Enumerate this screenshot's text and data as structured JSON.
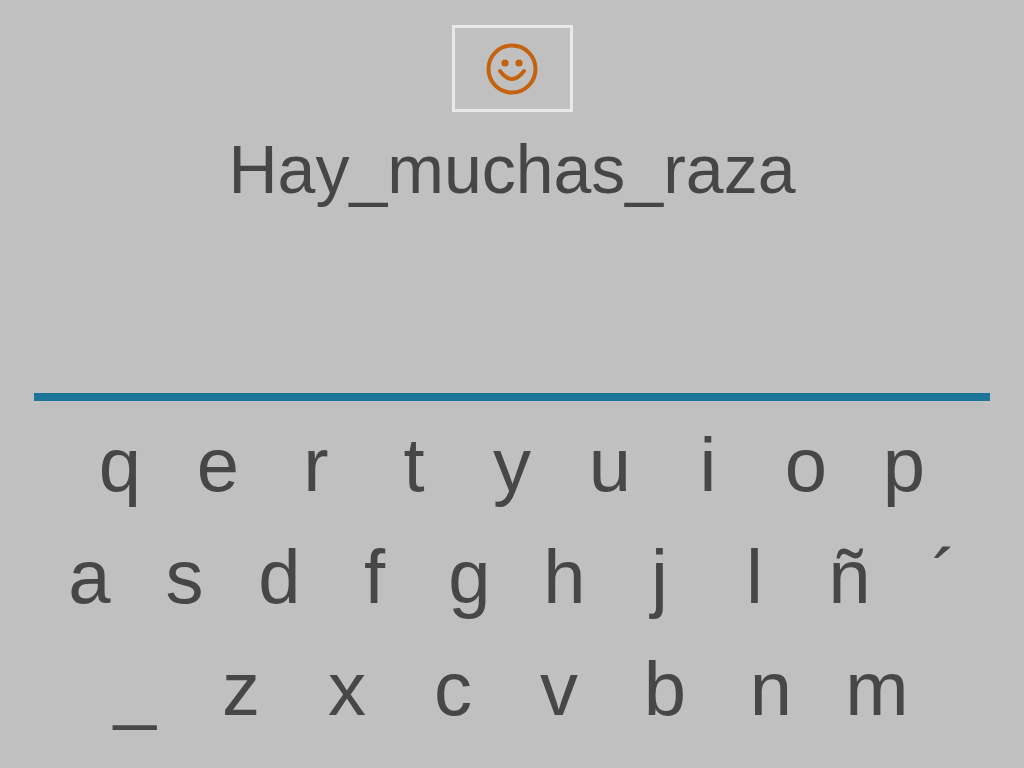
{
  "prompt": {
    "text": "Hay_muchas_raza"
  },
  "keyboard": {
    "rows": [
      [
        "q",
        "e",
        "r",
        "t",
        "y",
        "u",
        "i",
        "o",
        "p"
      ],
      [
        "a",
        "s",
        "d",
        "f",
        "g",
        "h",
        "j",
        "l",
        "ñ",
        "´"
      ],
      [
        "_",
        "z",
        "x",
        "c",
        "v",
        "b",
        "n",
        "m"
      ]
    ]
  }
}
